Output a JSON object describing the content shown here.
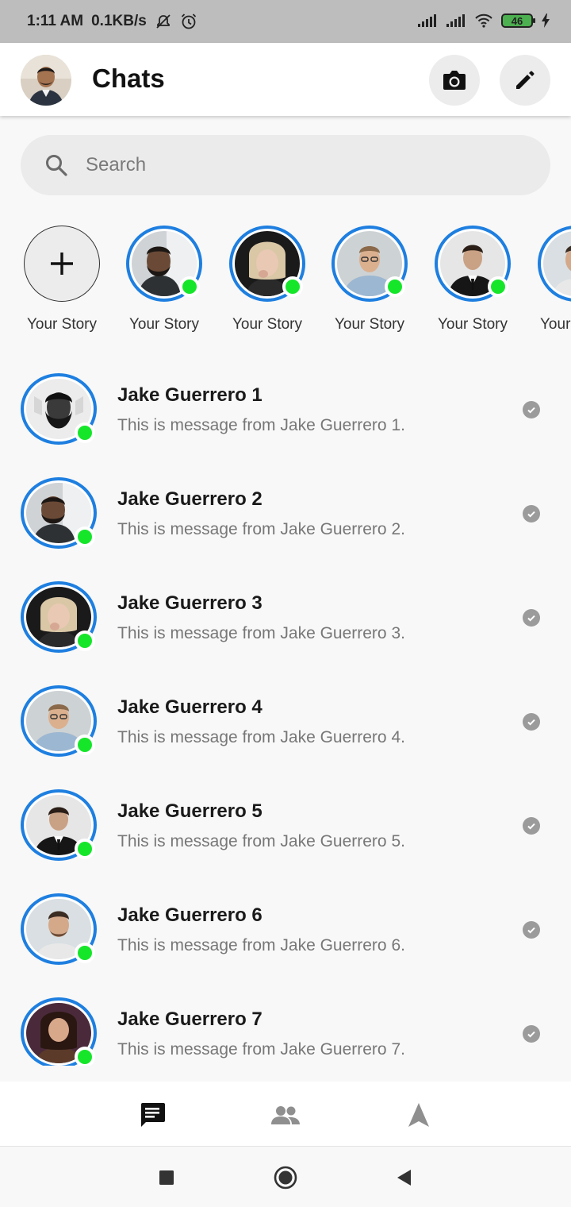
{
  "status_bar": {
    "time": "1:11 AM",
    "network_speed": "0.1KB/s",
    "battery_level": "46"
  },
  "header": {
    "title": "Chats",
    "camera_icon": "camera-icon",
    "edit_icon": "pencil-icon"
  },
  "search": {
    "placeholder": "Search",
    "value": ""
  },
  "stories": [
    {
      "label": "Your Story",
      "type": "add"
    },
    {
      "label": "Your Story",
      "online": true
    },
    {
      "label": "Your Story",
      "online": true
    },
    {
      "label": "Your Story",
      "online": true
    },
    {
      "label": "Your Story",
      "online": true
    },
    {
      "label": "Your"
    }
  ],
  "chats": [
    {
      "name": "Jake Guerrero 1",
      "message": "This is message from Jake Guerrero 1.",
      "online": true
    },
    {
      "name": "Jake Guerrero 2",
      "message": "This is message from Jake Guerrero 2.",
      "online": true
    },
    {
      "name": "Jake Guerrero 3",
      "message": "This is message from Jake Guerrero 3.",
      "online": true
    },
    {
      "name": "Jake Guerrero 4",
      "message": "This is message from Jake Guerrero 4.",
      "online": true
    },
    {
      "name": "Jake Guerrero 5",
      "message": "This is message from Jake Guerrero 5.",
      "online": true
    },
    {
      "name": "Jake Guerrero 6",
      "message": "This is message from Jake Guerrero 6.",
      "online": true
    },
    {
      "name": "Jake Guerrero 7",
      "message": "This is message from Jake Guerrero 7.",
      "online": true
    }
  ],
  "bottom_nav": {
    "items": [
      "chats-icon",
      "people-icon",
      "discover-icon"
    ],
    "active": "chats-icon"
  },
  "colors": {
    "accent": "#1e7fe0",
    "online": "#16e62a",
    "status_bar": "#bdbdbd"
  }
}
